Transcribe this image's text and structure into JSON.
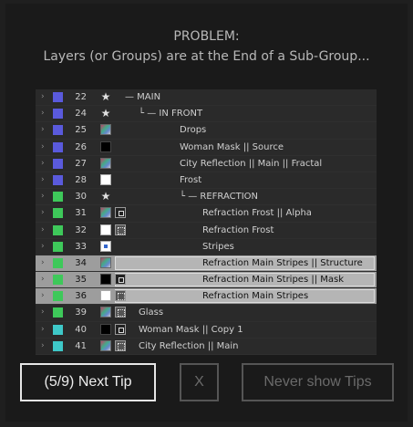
{
  "dialog": {
    "title": "PROBLEM:",
    "subtitle": "Layers (or Groups) are at the End of a Sub-Group..."
  },
  "layers": [
    {
      "num": "22",
      "color": "#5a5adc",
      "icon_a": "star",
      "icon_b": "",
      "name": "— MAIN",
      "tree": true,
      "indent": 2,
      "highlight": false
    },
    {
      "num": "24",
      "color": "#5a5adc",
      "icon_a": "star",
      "icon_b": "",
      "name": "└ — IN FRONT",
      "tree": true,
      "indent": 3,
      "highlight": false
    },
    {
      "num": "25",
      "color": "#5a5adc",
      "icon_a": "img",
      "icon_b": "",
      "name": "Drops",
      "tree": false,
      "indent": 4,
      "highlight": false
    },
    {
      "num": "26",
      "color": "#5a5adc",
      "icon_a": "black",
      "icon_b": "",
      "name": "Woman Mask || Source",
      "tree": false,
      "indent": 4,
      "highlight": false
    },
    {
      "num": "27",
      "color": "#5a5adc",
      "icon_a": "img",
      "icon_b": "",
      "name": "City Reflection || Main || Fractal",
      "tree": false,
      "indent": 4,
      "highlight": false
    },
    {
      "num": "28",
      "color": "#5a5adc",
      "icon_a": "white",
      "icon_b": "",
      "name": "Frost",
      "tree": false,
      "indent": 4,
      "highlight": false
    },
    {
      "num": "30",
      "color": "#3ec85a",
      "icon_a": "star",
      "icon_b": "",
      "name": "└ — REFRACTION",
      "tree": true,
      "indent": 4,
      "highlight": false
    },
    {
      "num": "31",
      "color": "#3ec85a",
      "icon_a": "img",
      "icon_b": "mask",
      "name": "Refraction Frost || Alpha",
      "tree": false,
      "indent": 5,
      "highlight": false
    },
    {
      "num": "32",
      "color": "#3ec85a",
      "icon_a": "white",
      "icon_b": "fx",
      "name": "Refraction Frost",
      "tree": false,
      "indent": 5,
      "highlight": false
    },
    {
      "num": "33",
      "color": "#3ec85a",
      "icon_a": "doc",
      "icon_b": "",
      "name": "Stripes",
      "tree": false,
      "indent": 5,
      "highlight": false
    },
    {
      "num": "34",
      "color": "#3ec85a",
      "icon_a": "img",
      "icon_b": "",
      "name": "Refraction Main Stripes || Structure",
      "tree": false,
      "indent": 5,
      "highlight": true
    },
    {
      "num": "35",
      "color": "#3ec85a",
      "icon_a": "black",
      "icon_b": "mask",
      "name": "Refraction Main Stripes || Mask",
      "tree": false,
      "indent": 5,
      "highlight": true
    },
    {
      "num": "36",
      "color": "#3ec85a",
      "icon_a": "white",
      "icon_b": "fx",
      "name": "Refraction Main Stripes",
      "tree": false,
      "indent": 5,
      "highlight": true
    },
    {
      "num": "39",
      "color": "#3ec85a",
      "icon_a": "img",
      "icon_b": "fx",
      "name": "Glass",
      "tree": false,
      "indent": 3,
      "highlight": false
    },
    {
      "num": "40",
      "color": "#3ec8c8",
      "icon_a": "black",
      "icon_b": "mask",
      "name": "Woman Mask || Copy 1",
      "tree": false,
      "indent": 3,
      "highlight": false
    },
    {
      "num": "41",
      "color": "#3ec8c8",
      "icon_a": "img",
      "icon_b": "fx",
      "name": "City Reflection || Main",
      "tree": false,
      "indent": 3,
      "highlight": false
    }
  ],
  "buttons": {
    "next": "(5/9) Next Tip",
    "close": "X",
    "never": "Never show Tips"
  }
}
